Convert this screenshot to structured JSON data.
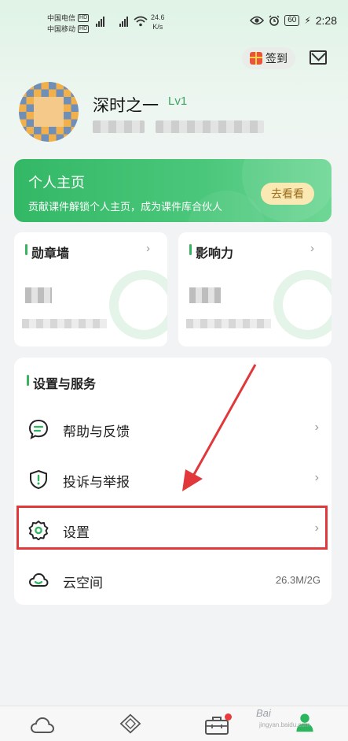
{
  "status_bar": {
    "carrier1": "中国电信",
    "carrier2": "中国移动",
    "hd": "HD",
    "network": "4G",
    "speed_value": "24.6",
    "speed_unit": "K/s",
    "battery": "60",
    "time": "2:28"
  },
  "header": {
    "signin_label": "签到"
  },
  "profile": {
    "username": "深时之一",
    "level": "Lv1"
  },
  "banner": {
    "title": "个人主页",
    "subtitle": "贡献课件解锁个人主页，成为课件库合伙人",
    "button": "去看看"
  },
  "cards": [
    {
      "title": "勋章墙"
    },
    {
      "title": "影响力"
    }
  ],
  "services": {
    "title": "设置与服务",
    "items": [
      {
        "label": "帮助与反馈",
        "icon": "chat-icon"
      },
      {
        "label": "投诉与举报",
        "icon": "shield-alert-icon"
      },
      {
        "label": "设置",
        "icon": "gear-icon"
      },
      {
        "label": "云空间",
        "icon": "cloud-icon",
        "value": "26.3M/2G"
      }
    ]
  },
  "bottom_nav": {
    "items": [
      "cloud-icon",
      "diamond-icon",
      "toolbox-icon",
      "profile-icon"
    ],
    "active_color": "#2bb55c"
  },
  "watermark": {
    "text": "Bai",
    "sub": "jingyan.baidu.com"
  },
  "colors": {
    "accent": "#39b35f",
    "highlight_border": "#e0383b"
  }
}
